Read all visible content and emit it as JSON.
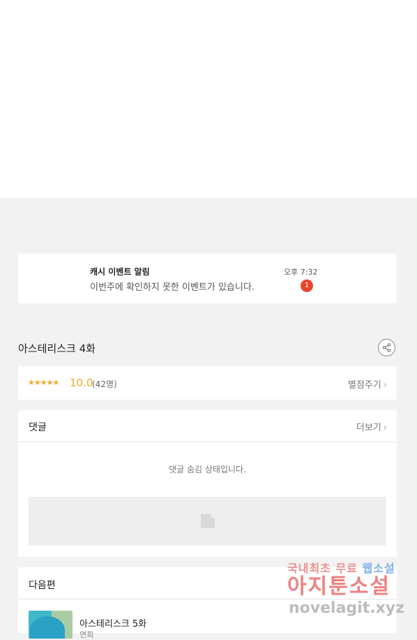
{
  "notification": {
    "title": "캐시 이벤트 알림",
    "message": "이번주에 확인하지 못한 이벤트가 있습니다.",
    "time": "오후 7:32",
    "badge": "1"
  },
  "episode": {
    "title": "아스테리스크 4화"
  },
  "rating": {
    "stars": "★★★★★",
    "score": "10.0",
    "count": "(42명)",
    "rate_label": "별점주기"
  },
  "comments": {
    "header": "댓글",
    "more_label": "더보기",
    "hidden_message": "댓글 숨김 상태입니다."
  },
  "next_episode": {
    "header": "다음편",
    "title": "아스테리스크 5화",
    "subtitle": "연희"
  },
  "watermark": {
    "line1_a": "국내최초 무료 ",
    "line1_b": "웹소설",
    "line2": "아지툰소설",
    "line3": "novelagit.xyz"
  },
  "colors": {
    "accent_star": "#f5a623",
    "badge_red": "#e8472e",
    "background": "#f2f2f2"
  }
}
